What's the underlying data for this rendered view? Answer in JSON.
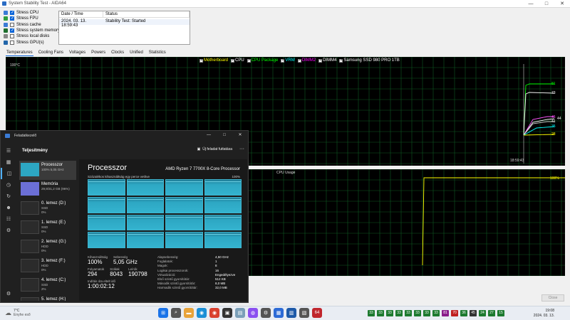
{
  "window": {
    "title": "System Stability Test - AIDA64"
  },
  "stress_options": [
    {
      "label": "Stress CPU",
      "checked": true,
      "icon_color": "#3a7bd5"
    },
    {
      "label": "Stress FPU",
      "checked": true,
      "icon_color": "#2e9e3e"
    },
    {
      "label": "Stress cache",
      "checked": false,
      "icon_color": "#3a7bd5"
    },
    {
      "label": "Stress system memory",
      "checked": true,
      "icon_color": "#1f6f2e"
    },
    {
      "label": "Stress local disks",
      "checked": false,
      "icon_color": "#888888"
    },
    {
      "label": "Stress GPU(s)",
      "checked": false,
      "icon_color": "#2266aa"
    }
  ],
  "status_table": {
    "headers": [
      "Date / Time",
      "Status"
    ],
    "rows": [
      [
        "2024. 03. 13. 18:59:43",
        "Stability Test: Started"
      ]
    ]
  },
  "tabs": [
    "Temperatures",
    "Cooling Fans",
    "Voltages",
    "Powers",
    "Clocks",
    "Unified",
    "Statistics"
  ],
  "active_tab": "Temperatures",
  "temp_legend": [
    {
      "label": "Motherboard",
      "color": "#ffff00"
    },
    {
      "label": "CPU",
      "color": "#ffffff"
    },
    {
      "label": "CPU Package",
      "color": "#00ff00"
    },
    {
      "label": "VRM",
      "color": "#00ffff"
    },
    {
      "label": "DIMM2",
      "color": "#ff00ff"
    },
    {
      "label": "DIMM4",
      "color": "#ffffff"
    },
    {
      "label": "Samsung SSD 980 PRO 1TB",
      "color": "#ffffff"
    }
  ],
  "temp_graph": {
    "ymax_label": "100°C",
    "time_label": "18:59:43",
    "end_values": [
      {
        "label": "81",
        "color": "#00ff00"
      },
      {
        "label": "73",
        "color": "#ffffff"
      },
      {
        "label": "45",
        "color": "#ff55ff"
      },
      {
        "label": "44",
        "color": "#ffffff"
      },
      {
        "label": "41",
        "color": "#ffffff"
      },
      {
        "label": "35",
        "color": "#00ffff"
      },
      {
        "label": "28",
        "color": "#ffff00"
      }
    ]
  },
  "cpu_graph": {
    "title": "CPU Usage",
    "max_label": "100%"
  },
  "close_label": "Close",
  "task_manager": {
    "title": "Feladatkezelő",
    "section": "Teljesítmény",
    "run_task": "Új feladat futtatása",
    "more": "···",
    "side_items": [
      {
        "name": "Processzor",
        "sub": "100% 5,05 GHz",
        "thumb": "#2da7c3"
      },
      {
        "name": "Memória",
        "sub": "29,9/31,2 GB (96%)",
        "thumb": "#6b6fd6"
      },
      {
        "name": "0. lemez (D:)",
        "sub": "SSD",
        "sub2": "0%",
        "thumb": "#2b2b2b"
      },
      {
        "name": "1. lemez (E:)",
        "sub": "SSD",
        "sub2": "0%",
        "thumb": "#2b2b2b"
      },
      {
        "name": "2. lemez (G:)",
        "sub": "HDD",
        "sub2": "0%",
        "thumb": "#2b2b2b"
      },
      {
        "name": "3. lemez (F:)",
        "sub": "HDD",
        "sub2": "0%",
        "thumb": "#2b2b2b"
      },
      {
        "name": "4. lemez (C:)",
        "sub": "SSD",
        "sub2": "2%",
        "thumb": "#2b2b2b"
      },
      {
        "name": "5. lemez (H:)",
        "sub": "SSD",
        "sub2": "",
        "thumb": "#2b2b2b"
      }
    ],
    "main": {
      "title": "Processzor",
      "cpu_name": "AMD Ryzen 7 7700X 8-Core Processor",
      "util_caption": "Százalékos kihasználtság egy perce vetítve",
      "util_pct": "100%",
      "stats": {
        "util_label": "Kihasználtság",
        "util_value": "100%",
        "speed_label": "Sebesség",
        "speed_value": "5,05 GHz",
        "proc_label": "Folyamatok",
        "proc_value": "294",
        "threads_label": "Szálak",
        "threads_value": "8043",
        "handles_label": "Leírók",
        "handles_value": "190798",
        "uptime_label": "Indítás óta eltelt idő",
        "uptime_value": "1:00:02:12"
      },
      "details": [
        {
          "k": "Alapsebesség:",
          "v": "4,50 GHz"
        },
        {
          "k": "Foglalatok:",
          "v": "1"
        },
        {
          "k": "Magok:",
          "v": "8"
        },
        {
          "k": "Logikai processzorok:",
          "v": "16"
        },
        {
          "k": "Virtualizáció:",
          "v": "Engedélyezve"
        },
        {
          "k": "Első szintű gyorsítótár:",
          "v": "512 KB"
        },
        {
          "k": "Második szintű gyorsítótár:",
          "v": "8,0 MB"
        },
        {
          "k": "Harmadik szintű gyorsítótár:",
          "v": "32,0 MB"
        }
      ]
    }
  },
  "taskbar": {
    "weather_temp": "7°C",
    "weather_desc": "Enyhe eső",
    "apps": [
      {
        "name": "start",
        "color": "#1a73e8",
        "glyph": "⊞"
      },
      {
        "name": "search",
        "color": "#555555",
        "glyph": "⌕"
      },
      {
        "name": "files",
        "color": "#e8a33a",
        "glyph": "▬"
      },
      {
        "name": "edge",
        "color": "#1b8fd6",
        "glyph": "◉"
      },
      {
        "name": "chrome",
        "color": "#d9412f",
        "glyph": "◉"
      },
      {
        "name": "app-dark",
        "color": "#333333",
        "glyph": "▣"
      },
      {
        "name": "app-photo",
        "color": "#7a9fb8",
        "glyph": "▤"
      },
      {
        "name": "messenger",
        "color": "#8a4ff0",
        "glyph": "◍"
      },
      {
        "name": "settings",
        "color": "#555555",
        "glyph": "⚙"
      },
      {
        "name": "app-blue",
        "color": "#2d6bd6",
        "glyph": "▦"
      },
      {
        "name": "app-teal",
        "color": "#1e5aa8",
        "glyph": "▥"
      },
      {
        "name": "app-gray",
        "color": "#555555",
        "glyph": "▧"
      },
      {
        "name": "aida64",
        "color": "#c0262d",
        "glyph": "64"
      }
    ],
    "tray": [
      {
        "label": "33",
        "color": "#1d7a2f"
      },
      {
        "label": "33",
        "color": "#1d7a2f"
      },
      {
        "label": "33",
        "color": "#1d7a2f"
      },
      {
        "label": "33",
        "color": "#1d7a2f"
      },
      {
        "label": "33",
        "color": "#1d7a2f"
      },
      {
        "label": "33",
        "color": "#1d7a2f"
      },
      {
        "label": "33",
        "color": "#1d7a2f"
      },
      {
        "label": "33",
        "color": "#1d7a2f"
      },
      {
        "label": "81",
        "color": "#8a1c8a"
      },
      {
        "label": "70",
        "color": "#c02020"
      },
      {
        "label": "36",
        "color": "#1d7a2f"
      },
      {
        "label": "45",
        "color": "#333333"
      },
      {
        "label": "24",
        "color": "#1d7a2f"
      },
      {
        "label": "27",
        "color": "#1d7a2f"
      },
      {
        "label": "15",
        "color": "#1d7a2f"
      }
    ],
    "time": "19:08",
    "date": "2024. 03. 13."
  }
}
